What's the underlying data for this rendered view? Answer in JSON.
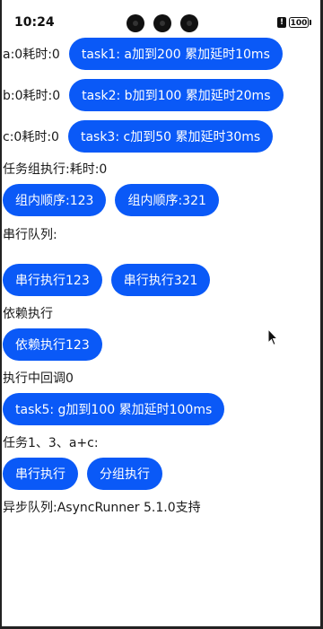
{
  "status_bar": {
    "time": "10:24",
    "battery": "100"
  },
  "task_rows": [
    {
      "label": "a:0耗时:0",
      "button": "task1: a加到200 累加延时10ms"
    },
    {
      "label": "b:0耗时:0",
      "button": "task2: b加到100 累加延时20ms"
    },
    {
      "label": "c:0耗时:0",
      "button": "task3: c加到50 累加延时30ms"
    }
  ],
  "group": {
    "title": "任务组执行:耗时:0",
    "buttons": [
      "组内顺序:123",
      "组内顺序:321"
    ]
  },
  "serial": {
    "title": "串行队列:",
    "buttons": [
      "串行执行123",
      "串行执行321"
    ]
  },
  "dependency": {
    "title": "依赖执行",
    "button": "依赖执行123"
  },
  "callback": {
    "title": "执行中回调0",
    "button": "task5: g加到100 累加延时100ms"
  },
  "tasks_ac": {
    "title": "任务1、3、a+c:",
    "buttons": [
      "串行执行",
      "分组执行"
    ]
  },
  "async_queue": {
    "title": "异步队列:AsyncRunner 5.1.0支持"
  },
  "colors": {
    "button_bg": "#0a59f7",
    "button_text": "#ffffff",
    "text": "#1a1a1a"
  }
}
